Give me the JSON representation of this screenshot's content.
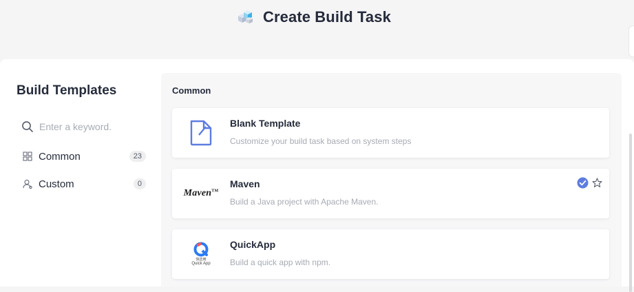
{
  "header": {
    "title": "Create Build Task",
    "icon": "cubes-icon"
  },
  "sidebar": {
    "title": "Build Templates",
    "search": {
      "placeholder": "Enter a keyword.",
      "value": ""
    },
    "items": [
      {
        "label": "Common",
        "count": "23",
        "icon": "grid-icon"
      },
      {
        "label": "Custom",
        "count": "0",
        "icon": "user-icon"
      }
    ]
  },
  "content": {
    "section_title": "Common",
    "templates": [
      {
        "name": "Blank Template",
        "description": "Customize your build task based on system steps",
        "logo": "blank-document-icon"
      },
      {
        "name": "Maven",
        "description": "Build a Java project with Apache Maven.",
        "logo": "maven-logo",
        "logo_text": "Maven",
        "logo_tm": "TM",
        "selected": true,
        "favorite": false
      },
      {
        "name": "QuickApp",
        "description": "Build a quick app with npm.",
        "logo": "quickapp-logo",
        "logo_text_cn": "快应用",
        "logo_text_en": "Quick App"
      }
    ]
  },
  "colors": {
    "accent": "#5e7ce0",
    "text_primary": "#252b3a",
    "text_muted": "#a7abb3"
  }
}
